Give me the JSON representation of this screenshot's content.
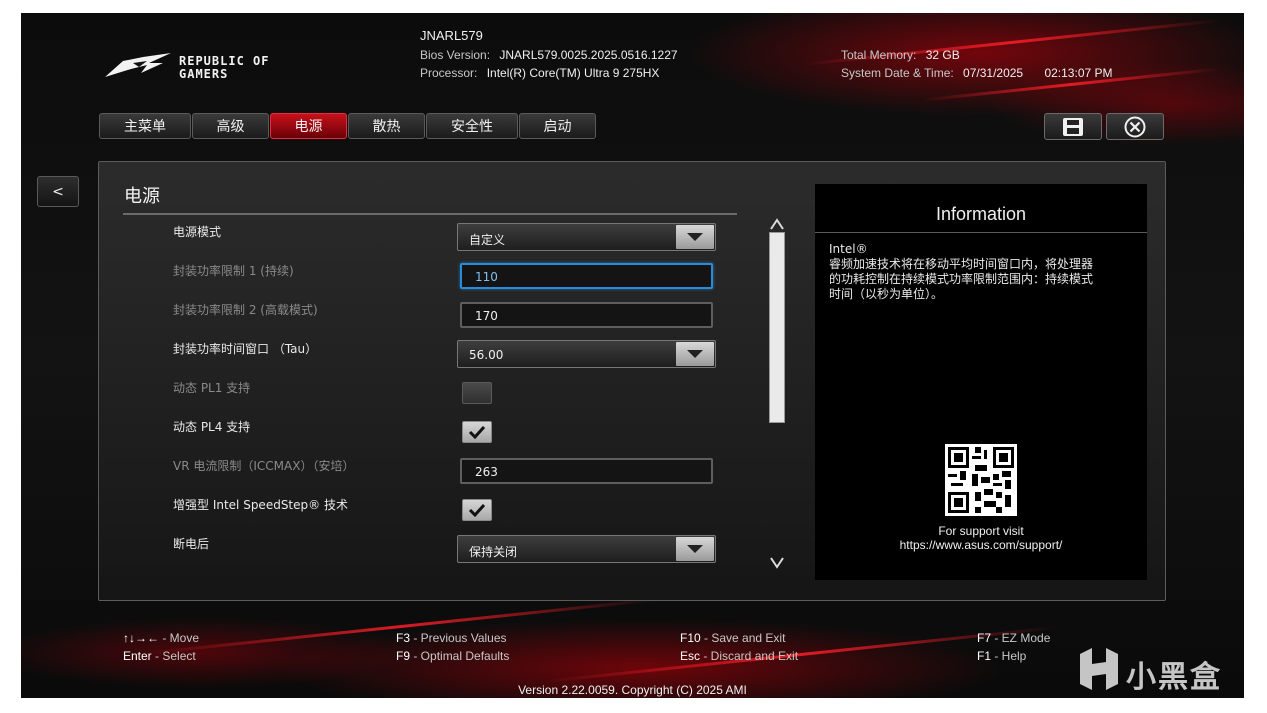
{
  "brand": {
    "logo_line1": "REPUBLIC OF",
    "logo_line2": "GAMERS"
  },
  "header": {
    "model": "JNARL579",
    "bios_label": "Bios Version:",
    "bios_value": "JNARL579.0025.2025.0516.1227",
    "processor_label": "Processor:",
    "processor_value": "Intel(R) Core(TM) Ultra 9 275HX",
    "memory_label": "Total Memory:",
    "memory_value": "32 GB",
    "datetime_label": "System Date & Time:",
    "date_value": "07/31/2025",
    "time_value": "02:13:07 PM"
  },
  "tabs": [
    {
      "label": "主菜单",
      "active": false
    },
    {
      "label": "高级",
      "active": false
    },
    {
      "label": "电源",
      "active": true
    },
    {
      "label": "散热",
      "active": false
    },
    {
      "label": "安全性",
      "active": false
    },
    {
      "label": "启动",
      "active": false
    }
  ],
  "toolbar": {
    "save_icon": "save-icon",
    "exit_icon": "close-circle-icon"
  },
  "nav": {
    "back_label": "<"
  },
  "panel": {
    "title": "电源",
    "rows": [
      {
        "label": "电源模式",
        "type": "dropdown",
        "value": "自定义"
      },
      {
        "label": "封装功率限制 1 (持续)",
        "type": "text",
        "value": "110",
        "focused": true
      },
      {
        "label": "封装功率限制 2 (高载模式)",
        "type": "text",
        "value": "170"
      },
      {
        "label": "封装功率时间窗口 （Tau）",
        "type": "dropdown",
        "value": "56.00"
      },
      {
        "label": "动态 PL1 支持",
        "type": "checkbox",
        "checked": false,
        "disabled": true
      },
      {
        "label": "动态 PL4 支持",
        "type": "checkbox",
        "checked": true
      },
      {
        "label": "VR 电流限制（ICCMAX）（安培）",
        "type": "text",
        "value": "263"
      },
      {
        "label": "增强型 Intel SpeedStep® 技术",
        "type": "checkbox",
        "checked": true
      },
      {
        "label": "断电后",
        "type": "dropdown",
        "value": "保持关闭"
      }
    ]
  },
  "info": {
    "title": "Information",
    "line1": "Intel®",
    "line2": "睿频加速技术将在移动平均时间窗口内，将处理器",
    "line3": "的功耗控制在持续模式功率限制范围内：持续模式",
    "line4": "时间（以秒为单位）。",
    "support_line1": "For support visit",
    "support_line2": "https://www.asus.com/support/"
  },
  "help": {
    "move_key": "↑↓→←",
    "move_text": " - Move",
    "enter_key": "Enter",
    "enter_text": " - Select",
    "f3_key": "F3",
    "f3_text": " - Previous Values",
    "f9_key": "F9",
    "f9_text": " - Optimal Defaults",
    "f10_key": "F10",
    "f10_text": " - Save and Exit",
    "esc_key": "Esc",
    "esc_text": " - Discard and Exit",
    "f7_key": "F7",
    "f7_text": " - EZ Mode",
    "f1_key": "F1",
    "f1_text": " - Help"
  },
  "footer": {
    "version": "Version 2.22.0059. Copyright (C) 2025 AMI"
  },
  "watermark": {
    "text": "小黑盒"
  },
  "colors": {
    "accent": "#c8101a",
    "focus": "#2a8bd8",
    "background": "#111111"
  }
}
